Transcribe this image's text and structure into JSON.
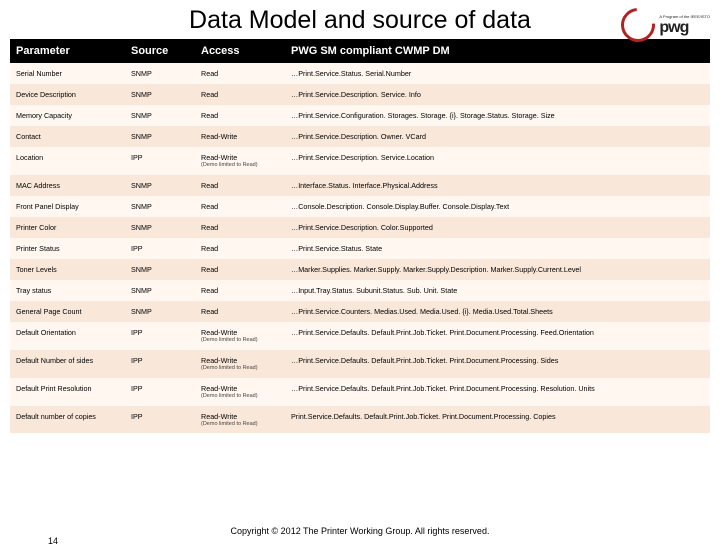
{
  "title": "Data Model and source of data",
  "logo": {
    "text": "pwg",
    "sub": "A Program of the IEEE/ISTO"
  },
  "columns": [
    "Parameter",
    "Source",
    "Access",
    "PWG SM compliant CWMP DM"
  ],
  "rows": [
    {
      "param": "Serial Number",
      "source": "SNMP",
      "access": "Read",
      "note": "",
      "dm": "…Print.Service.Status. Serial.Number"
    },
    {
      "param": "Device Description",
      "source": "SNMP",
      "access": "Read",
      "note": "",
      "dm": "…Print.Service.Description. Service. Info"
    },
    {
      "param": "Memory Capacity",
      "source": "SNMP",
      "access": "Read",
      "note": "",
      "dm": "…Print.Service.Configuration. Storages. Storage. {i}. Storage.Status. Storage. Size"
    },
    {
      "param": "Contact",
      "source": "SNMP",
      "access": "Read-Write",
      "note": "",
      "dm": "…Print.Service.Description. Owner. VCard"
    },
    {
      "param": "Location",
      "source": "IPP",
      "access": "Read-Write",
      "note": "(Demo limited to Read)",
      "dm": "…Print.Service.Description. Service.Location"
    },
    {
      "param": "MAC Address",
      "source": "SNMP",
      "access": "Read",
      "note": "",
      "dm": "…Interface.Status. Interface.Physical.Address"
    },
    {
      "param": "Front Panel Display",
      "source": "SNMP",
      "access": "Read",
      "note": "",
      "dm": "…Console.Description. Console.Display.Buffer. Console.Display.Text"
    },
    {
      "param": "Printer Color",
      "source": "SNMP",
      "access": "Read",
      "note": "",
      "dm": "…Print.Service.Description. Color.Supported"
    },
    {
      "param": "Printer Status",
      "source": "IPP",
      "access": "Read",
      "note": "",
      "dm": "…Print.Service.Status. State"
    },
    {
      "param": "Toner Levels",
      "source": "SNMP",
      "access": "Read",
      "note": "",
      "dm": "…Marker.Supplies. Marker.Supply. Marker.Supply.Description. Marker.Supply.Current.Level"
    },
    {
      "param": "Tray status",
      "source": "SNMP",
      "access": "Read",
      "note": "",
      "dm": "…Input.Tray.Status. Subunit.Status. Sub. Unit. State"
    },
    {
      "param": "General Page Count",
      "source": "SNMP",
      "access": "Read",
      "note": "",
      "dm": "…Print.Service.Counters. Medias.Used. Media.Used. {i}. Media.Used.Total.Sheets"
    },
    {
      "param": "Default Orientation",
      "source": "IPP",
      "access": "Read-Write",
      "note": "(Demo limited to Read)",
      "dm": "…Print.Service.Defaults. Default.Print.Job.Ticket. Print.Document.Processing. Feed.Orientation"
    },
    {
      "param": "Default Number of sides",
      "source": "IPP",
      "access": "Read-Write",
      "note": "(Demo limited to Read)",
      "dm": "…Print.Service.Defaults. Default.Print.Job.Ticket. Print.Document.Processing. Sides"
    },
    {
      "param": "Default Print Resolution",
      "source": "IPP",
      "access": "Read-Write",
      "note": "(Demo limited to Read)",
      "dm": "…Print.Service.Defaults. Default.Print.Job.Ticket. Print.Document.Processing. Resolution. Units"
    },
    {
      "param": "Default number of copies",
      "source": "IPP",
      "access": "Read-Write",
      "note": "(Demo limited to Read)",
      "dm": "Print.Service.Defaults. Default.Print.Job.Ticket. Print.Document.Processing. Copies"
    }
  ],
  "footer": "Copyright © 2012 The Printer Working Group. All rights reserved.",
  "footer_num": "14"
}
